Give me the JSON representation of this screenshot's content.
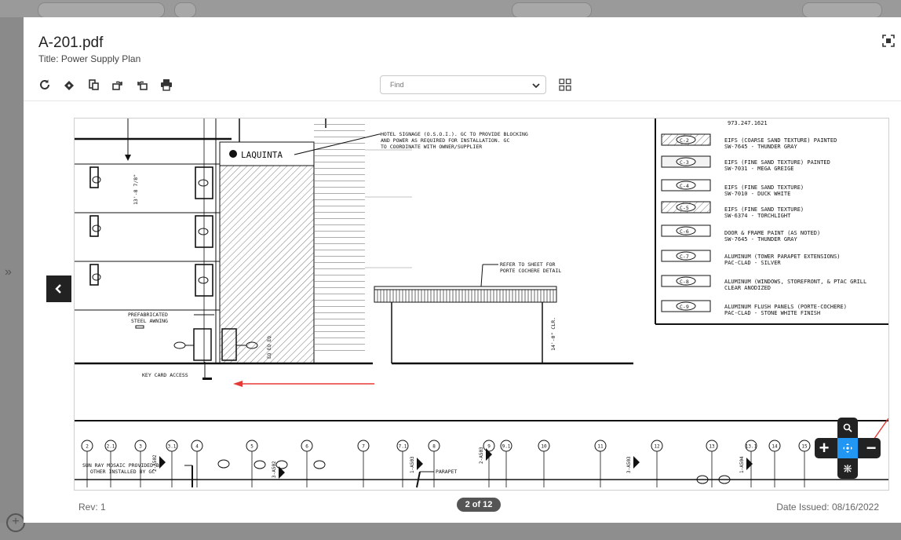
{
  "document": {
    "filename": "A-201.pdf",
    "subtitle": "Title: Power Supply Plan"
  },
  "toolbar": {
    "icons": [
      "refresh-icon",
      "sign-icon",
      "copy-icon",
      "rotate-right-icon",
      "rotate-left-icon",
      "print-icon"
    ]
  },
  "find": {
    "placeholder": "Find"
  },
  "footer": {
    "rev": "Rev: 1",
    "page_indicator": "2 of 12",
    "date_issued": "Date Issued: 08/16/2022"
  },
  "drawing": {
    "phone": "973.247.1621",
    "notes": {
      "signage_1": "HOTEL SIGNAGE (O.S.O.I.). GC TO PROVIDE BLOCKING",
      "signage_2": "AND POWER AS REQUIRED FOR INSTALLATION. GC",
      "signage_3": "TO COORDINATE WITH OWNER/SUPPLIER",
      "porte_1": "REFER TO SHEET FOR",
      "porte_2": "PORTE COCHERE DETAIL",
      "awning_1": "PREFABRICATED",
      "awning_2": "STEEL AWNING",
      "keycard": "KEY CARD ACCESS",
      "mosaic_1": "SUN RAY MOSAIC PROVIDED BY",
      "mosaic_2": "OTHER INSTALLED BY GC",
      "parapet": "PARAPET",
      "dim_1": "13'-8 7/8\"",
      "dim_2": "14'-0\" CLR.",
      "eq": "EQ  EQ  EQ"
    },
    "logo": "LAQUINTA",
    "legend": [
      {
        "tag": "C-2",
        "line1": "EIFS (COARSE SAND TEXTURE) PAINTED",
        "line2": "SW-7645 - THUNDER GRAY"
      },
      {
        "tag": "C-3",
        "line1": "EIFS (FINE SAND TEXTURE) PAINTED",
        "line2": "SW-7031 - MEGA GREIGE"
      },
      {
        "tag": "C-4",
        "line1": "EIFS (FINE SAND TEXTURE)",
        "line2": "SW-7010 - DUCK WHITE"
      },
      {
        "tag": "C-5",
        "line1": "EIFS (FINE SAND TEXTURE)",
        "line2": "SW-6374 - TORCHLIGHT"
      },
      {
        "tag": "C-6",
        "line1": "DOOR & FRAME PAINT (AS NOTED)",
        "line2": "SW-7645 - THUNDER GRAY"
      },
      {
        "tag": "C-7",
        "line1": "ALUMINUM (TOWER PARAPET EXTENSIONS)",
        "line2": "PAC-CLAD - SILVER"
      },
      {
        "tag": "C-8",
        "line1": "ALUMINUM (WINDOWS, STOREFRONT, & PTAC GRILL",
        "line2": "CLEAR ANODIZED"
      },
      {
        "tag": "C-9",
        "line1": "ALUMINUM FLUSH PANELS (PORTE-COCHERE)",
        "line2": "PAC-CLAD - STONE WHITE FINISH"
      }
    ],
    "grid_labels": [
      "2",
      "2.1",
      "3",
      "3.1",
      "4",
      "5",
      "6",
      "7",
      "7.1",
      "8",
      "9",
      "9.1",
      "10",
      "11",
      "12",
      "13",
      "13.1",
      "14",
      "15"
    ],
    "section_refs": [
      "2-A502",
      "3-A502",
      "1-A503",
      "2-A503",
      "3-A503",
      "1-A504"
    ]
  },
  "colors": {
    "zoom_center": "#2196f3",
    "annotation_arrow": "#e53935"
  }
}
